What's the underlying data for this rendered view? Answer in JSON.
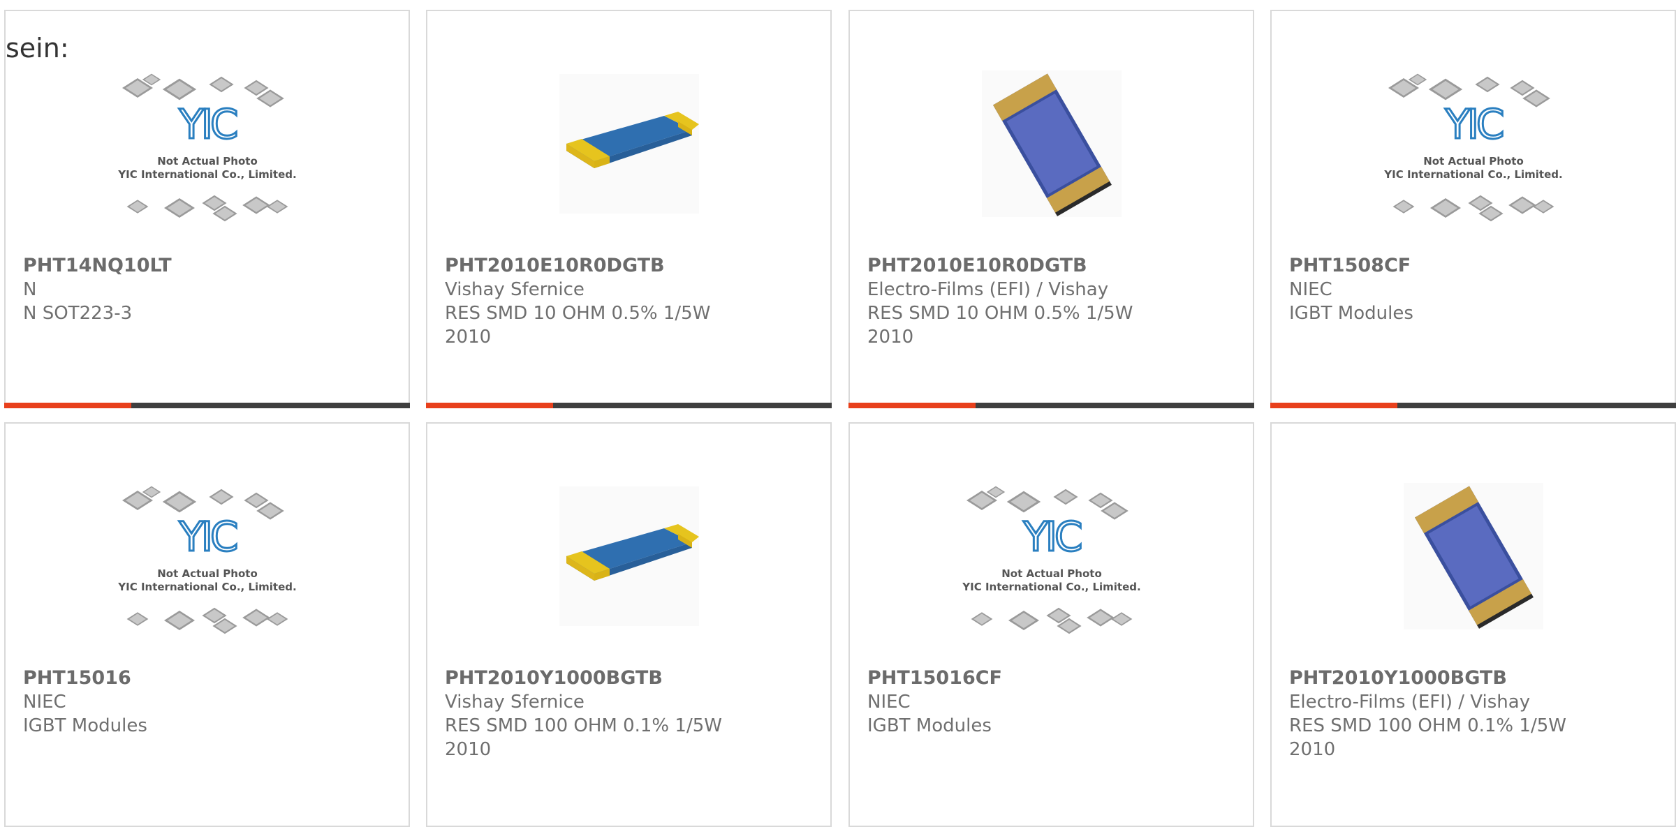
{
  "prefix_text": "sein:",
  "colors": {
    "accent": "#e8401c",
    "bar": "#3f3f3f",
    "border": "#d9d9d9",
    "text": "#6f6f6f"
  },
  "placeholder": {
    "line1": "Not Actual Photo",
    "line2": "YIC International Co., Limited.",
    "logo": "YIC"
  },
  "cards": [
    {
      "pn": "PHT14NQ10LT",
      "mfr": "N",
      "desc": "N SOT223-3",
      "desc2": "",
      "image": "yic-placeholder"
    },
    {
      "pn": "PHT2010E10R0DGTB",
      "mfr": "Vishay Sfernice",
      "desc": "RES SMD 10 OHM 0.5% 1/5W",
      "desc2": "2010",
      "image": "smd-resistor-flat"
    },
    {
      "pn": "PHT2010E10R0DGTB",
      "mfr": "Electro-Films (EFI) / Vishay",
      "desc": "RES SMD 10 OHM 0.5% 1/5W",
      "desc2": "2010",
      "image": "smd-resistor-tilted"
    },
    {
      "pn": "PHT1508CF",
      "mfr": "NIEC",
      "desc": "IGBT Modules",
      "desc2": "",
      "image": "yic-placeholder"
    },
    {
      "pn": "PHT15016",
      "mfr": "NIEC",
      "desc": "IGBT Modules",
      "desc2": "",
      "image": "yic-placeholder"
    },
    {
      "pn": "PHT2010Y1000BGTB",
      "mfr": "Vishay Sfernice",
      "desc": "RES SMD 100 OHM 0.1% 1/5W",
      "desc2": "2010",
      "image": "smd-resistor-flat"
    },
    {
      "pn": "PHT15016CF",
      "mfr": "NIEC",
      "desc": "IGBT Modules",
      "desc2": "",
      "image": "yic-placeholder"
    },
    {
      "pn": "PHT2010Y1000BGTB",
      "mfr": "Electro-Films (EFI) / Vishay",
      "desc": "RES SMD 100 OHM 0.1% 1/5W",
      "desc2": "2010",
      "image": "smd-resistor-tilted"
    }
  ]
}
